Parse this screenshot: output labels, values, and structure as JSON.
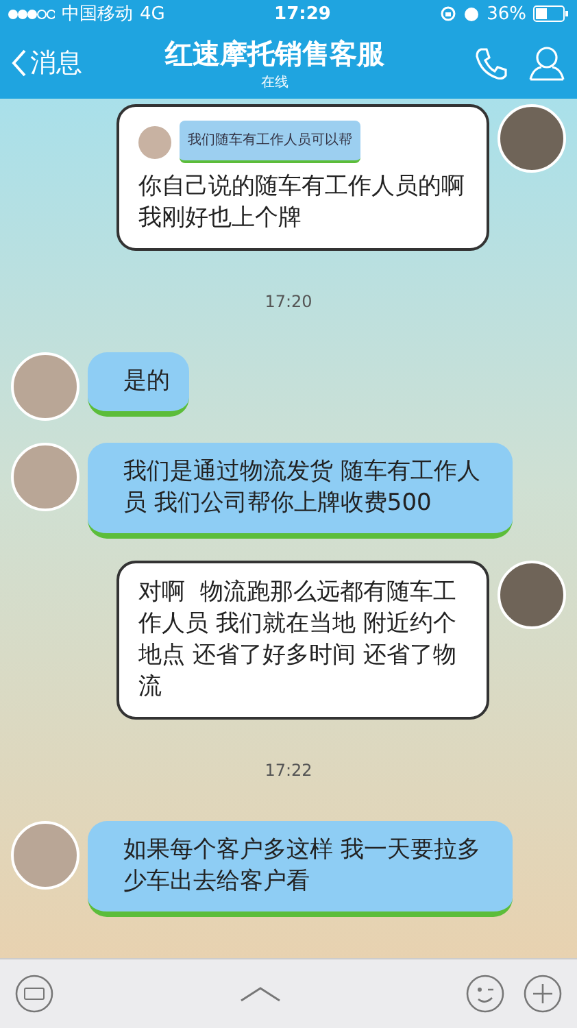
{
  "status_bar": {
    "carrier": "中国移动",
    "network": "4G",
    "time": "17:29",
    "battery": "36%"
  },
  "nav": {
    "back": "消息",
    "title": "红速摩托销售客服",
    "subtitle": "在线"
  },
  "messages": [
    {
      "kind": "outgoing",
      "quote": "我们随车有工作人员可以帮",
      "text": "你自己说的随车有工作人员的啊我刚好也上个牌"
    },
    {
      "kind": "time",
      "text": "17:20"
    },
    {
      "kind": "incoming",
      "text": "是的"
    },
    {
      "kind": "incoming",
      "text": "我们是通过物流发货 随车有工作人员 我们公司帮你上牌收费500"
    },
    {
      "kind": "outgoing",
      "text": "对啊  物流跑那么远都有随车工作人员 我们就在当地 附近约个地点 还省了好多时间 还省了物流"
    },
    {
      "kind": "time",
      "text": "17:22"
    },
    {
      "kind": "incoming",
      "text": "如果每个客户多这样 我一天要拉多少车出去给客户看"
    }
  ]
}
